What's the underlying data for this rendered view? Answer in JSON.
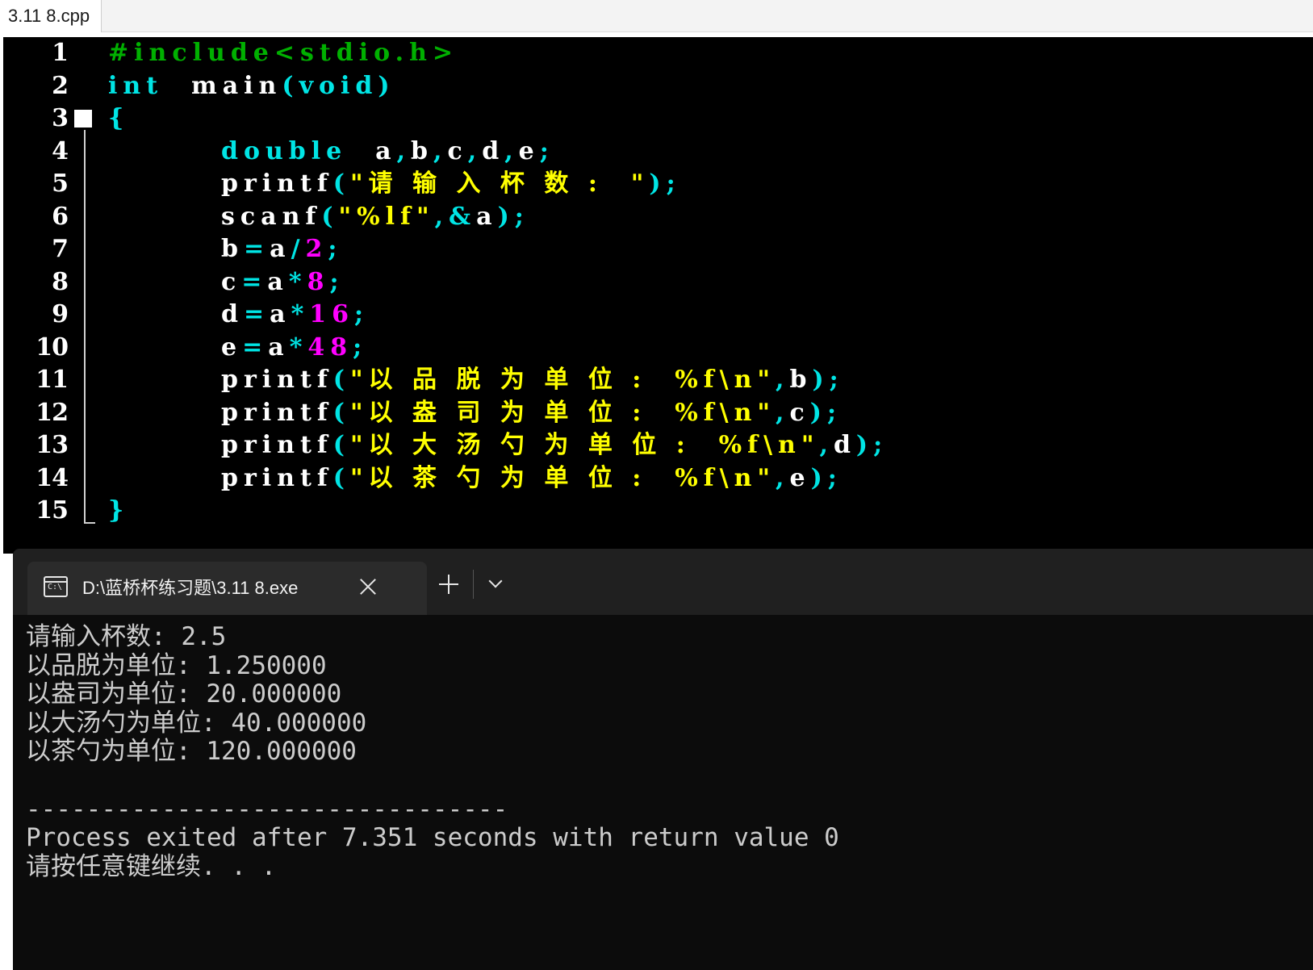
{
  "editor": {
    "file_tab": "3.11 8.cpp",
    "lines": [
      {
        "num": "1",
        "tokens": [
          {
            "t": "#include<stdio.h>",
            "c": "green"
          }
        ]
      },
      {
        "num": "2",
        "tokens": [
          {
            "t": "int",
            "c": "cyan"
          },
          {
            "t": "  main",
            "c": "white"
          },
          {
            "t": "(",
            "c": "cyan"
          },
          {
            "t": "void",
            "c": "cyan"
          },
          {
            "t": ")",
            "c": "cyan"
          }
        ]
      },
      {
        "num": "3",
        "tokens": [
          {
            "t": "{",
            "c": "cyan"
          }
        ]
      },
      {
        "num": "4",
        "indent": true,
        "tokens": [
          {
            "t": "double",
            "c": "cyan"
          },
          {
            "t": "  a",
            "c": "white"
          },
          {
            "t": ",",
            "c": "cyan"
          },
          {
            "t": "b",
            "c": "white"
          },
          {
            "t": ",",
            "c": "cyan"
          },
          {
            "t": "c",
            "c": "white"
          },
          {
            "t": ",",
            "c": "cyan"
          },
          {
            "t": "d",
            "c": "white"
          },
          {
            "t": ",",
            "c": "cyan"
          },
          {
            "t": "e",
            "c": "white"
          },
          {
            "t": ";",
            "c": "cyan"
          }
        ]
      },
      {
        "num": "5",
        "indent": true,
        "tokens": [
          {
            "t": "printf",
            "c": "white"
          },
          {
            "t": "(",
            "c": "cyan"
          },
          {
            "t": "\"请 输 入 杯 数 :  \"",
            "c": "yellow"
          },
          {
            "t": ");",
            "c": "cyan"
          }
        ]
      },
      {
        "num": "6",
        "indent": true,
        "tokens": [
          {
            "t": "scanf",
            "c": "white"
          },
          {
            "t": "(",
            "c": "cyan"
          },
          {
            "t": "\"%lf\"",
            "c": "yellow"
          },
          {
            "t": ",",
            "c": "cyan"
          },
          {
            "t": "&",
            "c": "cyan"
          },
          {
            "t": "a",
            "c": "white"
          },
          {
            "t": ");",
            "c": "cyan"
          }
        ]
      },
      {
        "num": "7",
        "indent": true,
        "tokens": [
          {
            "t": "b",
            "c": "white"
          },
          {
            "t": "=",
            "c": "cyan"
          },
          {
            "t": "a",
            "c": "white"
          },
          {
            "t": "/",
            "c": "cyan"
          },
          {
            "t": "2",
            "c": "magenta"
          },
          {
            "t": ";",
            "c": "cyan"
          }
        ]
      },
      {
        "num": "8",
        "indent": true,
        "tokens": [
          {
            "t": "c",
            "c": "white"
          },
          {
            "t": "=",
            "c": "cyan"
          },
          {
            "t": "a",
            "c": "white"
          },
          {
            "t": "*",
            "c": "cyan"
          },
          {
            "t": "8",
            "c": "magenta"
          },
          {
            "t": ";",
            "c": "cyan"
          }
        ]
      },
      {
        "num": "9",
        "indent": true,
        "tokens": [
          {
            "t": "d",
            "c": "white"
          },
          {
            "t": "=",
            "c": "cyan"
          },
          {
            "t": "a",
            "c": "white"
          },
          {
            "t": "*",
            "c": "cyan"
          },
          {
            "t": "16",
            "c": "magenta"
          },
          {
            "t": ";",
            "c": "cyan"
          }
        ]
      },
      {
        "num": "10",
        "indent": true,
        "tokens": [
          {
            "t": "e",
            "c": "white"
          },
          {
            "t": "=",
            "c": "cyan"
          },
          {
            "t": "a",
            "c": "white"
          },
          {
            "t": "*",
            "c": "cyan"
          },
          {
            "t": "48",
            "c": "magenta"
          },
          {
            "t": ";",
            "c": "cyan"
          }
        ]
      },
      {
        "num": "11",
        "indent": true,
        "tokens": [
          {
            "t": "printf",
            "c": "white"
          },
          {
            "t": "(",
            "c": "cyan"
          },
          {
            "t": "\"以 品 脱 为 单 位 :  %f\\n\"",
            "c": "yellow"
          },
          {
            "t": ",",
            "c": "cyan"
          },
          {
            "t": "b",
            "c": "white"
          },
          {
            "t": ");",
            "c": "cyan"
          }
        ]
      },
      {
        "num": "12",
        "indent": true,
        "tokens": [
          {
            "t": "printf",
            "c": "white"
          },
          {
            "t": "(",
            "c": "cyan"
          },
          {
            "t": "\"以 盎 司 为 单 位 :  %f\\n\"",
            "c": "yellow"
          },
          {
            "t": ",",
            "c": "cyan"
          },
          {
            "t": "c",
            "c": "white"
          },
          {
            "t": ");",
            "c": "cyan"
          }
        ]
      },
      {
        "num": "13",
        "indent": true,
        "tokens": [
          {
            "t": "printf",
            "c": "white"
          },
          {
            "t": "(",
            "c": "cyan"
          },
          {
            "t": "\"以 大 汤 勺 为 单 位 :  %f\\n\"",
            "c": "yellow"
          },
          {
            "t": ",",
            "c": "cyan"
          },
          {
            "t": "d",
            "c": "white"
          },
          {
            "t": ");",
            "c": "cyan"
          }
        ]
      },
      {
        "num": "14",
        "indent": true,
        "tokens": [
          {
            "t": "printf",
            "c": "white"
          },
          {
            "t": "(",
            "c": "cyan"
          },
          {
            "t": "\"以 茶 勺 为 单 位 :  %f\\n\"",
            "c": "yellow"
          },
          {
            "t": ",",
            "c": "cyan"
          },
          {
            "t": "e",
            "c": "white"
          },
          {
            "t": ");",
            "c": "cyan"
          }
        ]
      },
      {
        "num": "15",
        "tokens": [
          {
            "t": "}",
            "c": "cyan"
          }
        ]
      }
    ]
  },
  "terminal": {
    "icon_text": "C:\\",
    "tab_title": "D:\\蓝桥杯练习题\\3.11 8.exe",
    "output_lines": [
      "请输入杯数: 2.5",
      "以品脱为单位: 1.250000",
      "以盎司为单位: 20.000000",
      "以大汤勺为单位: 40.000000",
      "以茶勺为单位: 120.000000",
      "",
      "--------------------------------",
      "Process exited after 7.351 seconds with return value 0",
      "请按任意键继续. . ."
    ]
  },
  "colors": {
    "green": "#00b000",
    "cyan": "#00e5e5",
    "white": "#ffffff",
    "yellow": "#ffff00",
    "magenta": "#ff00ff",
    "editor_bg": "#000000",
    "terminal_bg": "#0c0c0c"
  }
}
